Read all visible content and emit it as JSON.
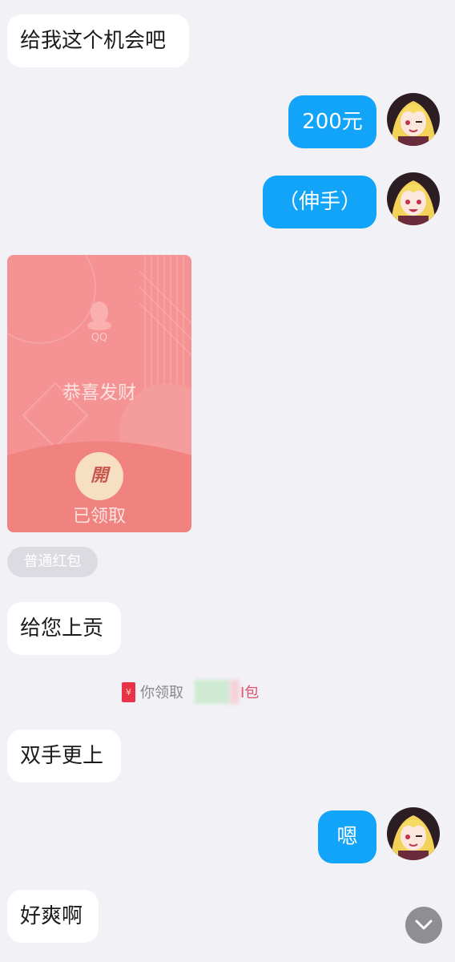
{
  "messages": {
    "m1": "给我这个机会吧",
    "m2": "200元",
    "m3": "（伸手）",
    "m4": "给您上贡",
    "m5": "双手更上",
    "m6": "嗯",
    "m7": "好爽啊"
  },
  "red_packet": {
    "brand": "QQ",
    "greeting": "恭喜发财",
    "open_char": "開",
    "status": "已领取",
    "type_tag": "普通红包",
    "icon": "red-packet-icon"
  },
  "notice": {
    "prefix": "你领取",
    "suffix": "I包",
    "icon_char": "¥"
  },
  "scroll_down_icon": "chevron-down-icon",
  "colors": {
    "background": "#f2f1f6",
    "outgoing_bubble": "#12a4f9",
    "incoming_bubble": "#ffffff",
    "red_packet": "#f49294"
  }
}
